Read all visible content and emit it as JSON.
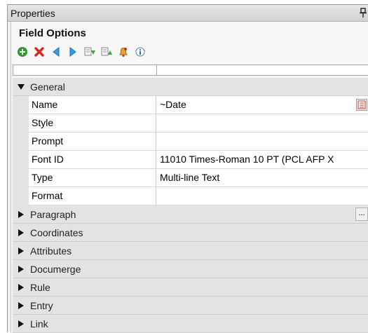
{
  "panel": {
    "title": "Properties"
  },
  "section": {
    "title": "Field Options"
  },
  "toolbar": {
    "icons": [
      "add-icon",
      "delete-icon",
      "move-left-icon",
      "move-right-icon",
      "move-down-icon",
      "move-up-icon",
      "bell-icon",
      "info-icon"
    ]
  },
  "groups": {
    "general": {
      "label": "General",
      "props": [
        {
          "name": "Name",
          "value": "~Date"
        },
        {
          "name": "Style",
          "value": ""
        },
        {
          "name": "Prompt",
          "value": ""
        },
        {
          "name": "Font ID",
          "value": "11010 Times-Roman 10 PT (PCL AFP X"
        },
        {
          "name": "Type",
          "value": "Multi-line Text"
        },
        {
          "name": "Format",
          "value": ""
        }
      ]
    },
    "collapsed": [
      {
        "label": "Paragraph"
      },
      {
        "label": "Coordinates"
      },
      {
        "label": "Attributes"
      },
      {
        "label": "Documerge"
      },
      {
        "label": "Rule"
      },
      {
        "label": "Entry"
      },
      {
        "label": "Link"
      }
    ]
  },
  "ellipsis_label": "...",
  "colors": {
    "category_bg": "#e3e3e3",
    "add": "#2e9a2e",
    "delete": "#d42a1e",
    "arrow": "#3a9be0"
  }
}
